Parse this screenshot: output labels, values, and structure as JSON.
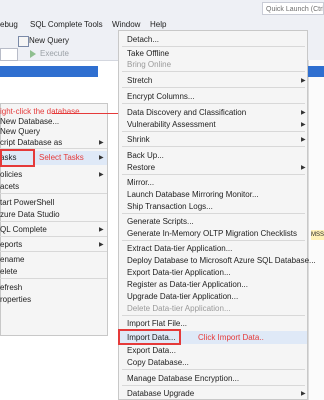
{
  "menubar": {
    "items": [
      "ebug",
      "SQL Complete",
      "Tools",
      "Window",
      "Help"
    ],
    "quick_launch_placeholder": "Quick Launch (Ctrl"
  },
  "toolbar": {
    "new_query": "New Query",
    "execute": "Execute"
  },
  "annotations": {
    "right_click": "ight-click the database",
    "select_tasks": "Select Tasks",
    "click_import": "Click Import Data.."
  },
  "left_menu": {
    "items": [
      "New Database...",
      "New Query",
      "cript Database as",
      "asks",
      "olicies",
      "acets",
      "tart PowerShell",
      "zure Data Studio",
      "QL Complete",
      "eports",
      "ename",
      "elete",
      "efresh",
      "roperties"
    ]
  },
  "right_menu": {
    "items": [
      "Detach...",
      "Take Offline",
      "Bring Online",
      "Stretch",
      "Encrypt Columns...",
      "Data Discovery and Classification",
      "Vulnerability Assessment",
      "Shrink",
      "Back Up...",
      "Restore",
      "Mirror...",
      "Launch Database Mirroring Monitor...",
      "Ship Transaction Logs...",
      "Generate Scripts...",
      "Generate In-Memory OLTP Migration Checklists",
      "Extract Data-tier Application...",
      "Deploy Database to Microsoft Azure SQL Database...",
      "Export Data-tier Application...",
      "Register as Data-tier Application...",
      "Upgrade Data-tier Application...",
      "Delete Data-tier Application...",
      "Import Flat File...",
      "Import Data...",
      "Export Data...",
      "Copy Database...",
      "Manage Database Encryption...",
      "Database Upgrade"
    ]
  },
  "background": {
    "ms_tag": "MSS"
  },
  "colors": {
    "accent_blue": "#2f6fd0",
    "annotation_red": "#e53a3a",
    "highlight": "#dfe9f7"
  }
}
